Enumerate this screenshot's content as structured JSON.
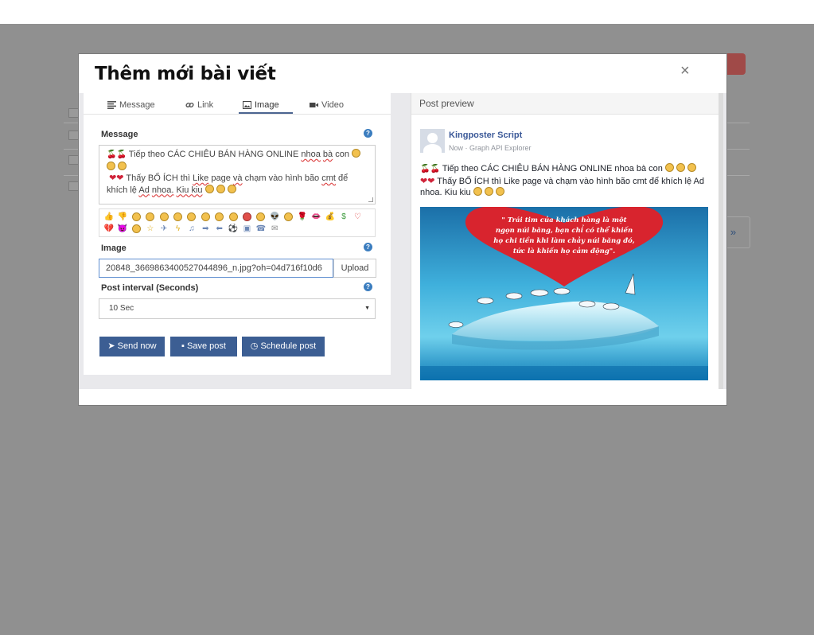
{
  "modal": {
    "title": "Thêm mới bài viết",
    "close": "×"
  },
  "tabs": [
    {
      "label": "Message",
      "icon": "align-left-icon"
    },
    {
      "label": "Link",
      "icon": "link-icon"
    },
    {
      "label": "Image",
      "icon": "image-icon",
      "active": true
    },
    {
      "label": "Video",
      "icon": "video-camera-icon"
    }
  ],
  "form": {
    "message_label": "Message",
    "message_line1": "Tiếp theo CÁC CHIÊU BÁN HÀNG ONLINE",
    "message_line1_nhoa": "nhoa",
    "message_line1_ba": "bà",
    "message_line1_con": "con",
    "message_line2_a": "Thấy BỔ ÍCH thì",
    "message_like": "Like",
    "message_line2_b": "page",
    "message_va": "và",
    "message_line2_c": "chạm vào hình bão",
    "message_cmt": "cmt",
    "message_line2_d": "để",
    "message_line3_a": "khích lệ",
    "message_ad": "Ad",
    "message_nhoa2": "nhoa.",
    "message_kiu": "Kiu kiu",
    "image_label": "Image",
    "image_value": "20848_3669863400527044896_n.jpg?oh=04d716f10d6",
    "upload_label": "Upload",
    "interval_label": "Post interval (Seconds)",
    "interval_value": "10 Sec",
    "send_now": "Send now",
    "save_post": "Save post",
    "schedule_post": "Schedule post"
  },
  "preview": {
    "header": "Post preview",
    "page_name": "Kingposter Script",
    "meta": "Now · Graph API Explorer",
    "line1": "Tiếp theo CÁC CHIÊU BÁN HÀNG ONLINE nhoa bà con",
    "line2": "Thấy BỔ ÍCH thì Like page và chạm vào hình bão cmt để khích lệ Ad",
    "line3": "nhoa. Kiu kiu",
    "image_caption_1": "\" Trái tim của khách hàng là một",
    "image_caption_2": "ngọn núi băng, bạn chỉ có thể khiến",
    "image_caption_3": "họ chi tiền khi làm chảy núi băng đó,",
    "image_caption_4": "tức là khiến họ cảm động\"."
  },
  "background": {
    "pager_next": "»"
  },
  "colors": {
    "primary_button": "#3c5e93",
    "link_blue": "#3b5998",
    "overlay": "#909090"
  }
}
